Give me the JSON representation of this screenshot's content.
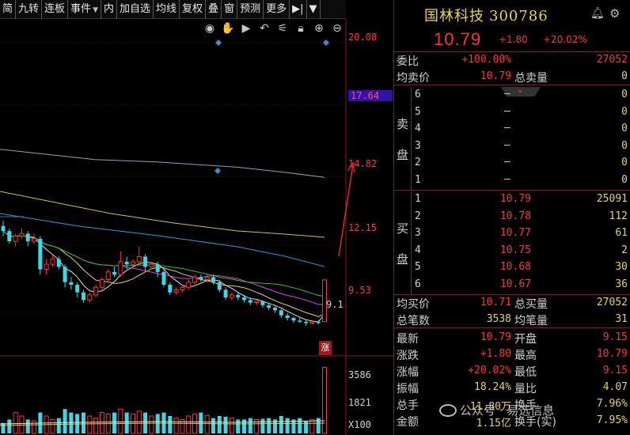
{
  "toolbar": {
    "items": [
      "简",
      "九转",
      "连板",
      "事件",
      "内",
      "加自选",
      "均线",
      "复权",
      "叠",
      "窗",
      "预测",
      "更多"
    ],
    "events_caret": "▼",
    "collapse_icon": "▶|",
    "menu_caret": "▼"
  },
  "chart_tools": [
    "eye-icon",
    "hand-icon",
    "play-icon",
    "undo-icon",
    "wand-icon",
    "lock-icon",
    "zoom-in-icon",
    "zoom-out-icon"
  ],
  "chart": {
    "y_labels": [
      "20.08",
      "17.64",
      "14.82",
      "12.15",
      "9.53"
    ],
    "highlight_label": "17.64",
    "low_tag": "9.1",
    "limit_tag": "涨",
    "volume_labels": [
      "3586",
      "1821",
      "X100"
    ]
  },
  "chart_data": {
    "type": "candlestick",
    "y_range": [
      8.0,
      21.0
    ],
    "candles": [
      [
        12.9,
        12.7,
        13.1,
        12.5
      ],
      [
        12.7,
        12.3,
        12.8,
        12.2
      ],
      [
        12.3,
        12.5,
        12.6,
        12.1
      ],
      [
        12.5,
        12.6,
        12.8,
        12.4
      ],
      [
        12.6,
        12.3,
        12.7,
        12.1
      ],
      [
        12.3,
        12.4,
        12.6,
        12.2
      ],
      [
        12.4,
        11.2,
        12.5,
        11.0
      ],
      [
        11.2,
        11.4,
        11.6,
        11.0
      ],
      [
        11.4,
        11.6,
        11.8,
        11.3
      ],
      [
        11.6,
        11.3,
        11.7,
        11.2
      ],
      [
        11.3,
        10.7,
        11.4,
        10.5
      ],
      [
        10.7,
        10.6,
        10.9,
        10.4
      ],
      [
        10.6,
        10.3,
        10.7,
        10.1
      ],
      [
        10.3,
        10.0,
        10.4,
        9.9
      ],
      [
        10.0,
        10.2,
        10.3,
        9.9
      ],
      [
        10.2,
        10.5,
        10.6,
        10.1
      ],
      [
        10.5,
        10.8,
        10.9,
        10.4
      ],
      [
        10.8,
        11.1,
        11.2,
        10.7
      ],
      [
        11.1,
        11.0,
        11.3,
        10.9
      ],
      [
        11.0,
        11.5,
        11.9,
        10.9
      ],
      [
        11.5,
        11.4,
        11.7,
        11.2
      ],
      [
        11.4,
        11.5,
        11.6,
        11.3
      ],
      [
        11.5,
        11.7,
        12.1,
        11.4
      ],
      [
        11.7,
        11.3,
        11.8,
        11.1
      ],
      [
        11.3,
        11.4,
        11.5,
        11.2
      ],
      [
        11.4,
        11.1,
        11.5,
        10.9
      ],
      [
        11.1,
        10.6,
        11.2,
        10.5
      ],
      [
        10.6,
        10.3,
        10.7,
        10.2
      ],
      [
        10.3,
        10.4,
        10.5,
        10.2
      ],
      [
        10.4,
        10.5,
        10.6,
        10.3
      ],
      [
        10.5,
        10.7,
        10.8,
        10.4
      ],
      [
        10.7,
        10.9,
        11.0,
        10.6
      ],
      [
        10.9,
        10.8,
        11.0,
        10.7
      ],
      [
        10.8,
        10.9,
        11.0,
        10.7
      ],
      [
        10.9,
        10.7,
        11.0,
        10.6
      ],
      [
        10.7,
        10.4,
        10.8,
        10.3
      ],
      [
        10.4,
        10.1,
        10.5,
        10.0
      ],
      [
        10.1,
        10.2,
        10.3,
        10.0
      ],
      [
        10.2,
        10.1,
        10.3,
        10.0
      ],
      [
        10.1,
        10.0,
        10.2,
        9.9
      ],
      [
        10.0,
        9.9,
        10.1,
        9.8
      ],
      [
        9.9,
        9.95,
        10.0,
        9.8
      ],
      [
        9.95,
        9.8,
        10.0,
        9.7
      ],
      [
        9.8,
        9.7,
        9.9,
        9.6
      ],
      [
        9.7,
        9.6,
        9.8,
        9.5
      ],
      [
        9.6,
        9.4,
        9.7,
        9.3
      ],
      [
        9.4,
        9.3,
        9.5,
        9.2
      ],
      [
        9.3,
        9.2,
        9.35,
        9.1
      ],
      [
        9.2,
        9.15,
        9.3,
        9.1
      ],
      [
        9.15,
        9.1,
        9.2,
        9.0
      ],
      [
        9.1,
        9.15,
        9.2,
        9.05
      ],
      [
        9.15,
        9.1,
        9.2,
        9.05
      ],
      [
        9.15,
        10.79,
        10.79,
        9.15
      ]
    ],
    "ma_long": [
      [
        0,
        15.9
      ],
      [
        60,
        15.7
      ],
      [
        120,
        15.5
      ],
      [
        200,
        15.4
      ],
      [
        300,
        15.2
      ],
      [
        360,
        15.0
      ],
      [
        410,
        14.8
      ]
    ],
    "volumes": [
      0.15,
      0.2,
      0.3,
      0.25,
      0.2,
      0.18,
      0.3,
      0.25,
      0.2,
      0.22,
      0.35,
      0.3,
      0.28,
      0.3,
      0.25,
      0.22,
      0.3,
      0.28,
      0.3,
      0.35,
      0.3,
      0.28,
      0.32,
      0.3,
      0.25,
      0.28,
      0.3,
      0.25,
      0.22,
      0.2,
      0.25,
      0.28,
      0.3,
      0.26,
      0.22,
      0.25,
      0.24,
      0.22,
      0.2,
      0.2,
      0.22,
      0.2,
      0.21,
      0.22,
      0.2,
      0.25,
      0.22,
      0.2,
      0.22,
      0.18,
      0.2,
      0.22,
      0.95
    ]
  },
  "quote": {
    "name": "国林科技",
    "code": "300786",
    "last": "10.79",
    "change": "+1.80",
    "change_pct": "+20.02%",
    "weibi_label": "委比",
    "weibi_pct": "+100.00%",
    "weibi_diff": "27052",
    "ask_avg_label": "均卖价",
    "ask_avg": "10.79",
    "ask_total_label": "总卖量",
    "ask_total": "0",
    "ask_side": [
      "卖",
      "盘"
    ],
    "asks": [
      {
        "level": "6",
        "price": "–",
        "vol": "0"
      },
      {
        "level": "5",
        "price": "–",
        "vol": "0"
      },
      {
        "level": "4",
        "price": "–",
        "vol": "0"
      },
      {
        "level": "3",
        "price": "–",
        "vol": "0"
      },
      {
        "level": "2",
        "price": "–",
        "vol": "0"
      },
      {
        "level": "1",
        "price": "–",
        "vol": "0"
      }
    ],
    "bid_side": [
      "买",
      "盘"
    ],
    "bids": [
      {
        "level": "1",
        "price": "10.79",
        "vol": "25091"
      },
      {
        "level": "2",
        "price": "10.78",
        "vol": "112"
      },
      {
        "level": "3",
        "price": "10.77",
        "vol": "61"
      },
      {
        "level": "4",
        "price": "10.75",
        "vol": "2"
      },
      {
        "level": "5",
        "price": "10.68",
        "vol": "30"
      },
      {
        "level": "6",
        "price": "10.67",
        "vol": "36"
      }
    ],
    "bid_avg_label": "均买价",
    "bid_avg": "10.71",
    "bid_total_label": "总买量",
    "bid_total": "27052",
    "trades_label": "总笔数",
    "trades": "3538",
    "avg_trade_label": "均笔量",
    "avg_trade": "31",
    "stats": [
      {
        "l1": "最新",
        "v1": "10.79",
        "l2": "开盘",
        "v2": "9.15"
      },
      {
        "l1": "涨跌",
        "v1": "+1.80",
        "l2": "最高",
        "v2": "10.79"
      },
      {
        "l1": "涨幅",
        "v1": "+20.02%",
        "l2": "最低",
        "v2": "9.15"
      },
      {
        "l1": "振幅",
        "v1": "18.24%",
        "l2": "量比",
        "v2": "4.07"
      },
      {
        "l1": "总手",
        "v1": "11.80万",
        "l2": "换手",
        "v2": "7.96%"
      },
      {
        "l1": "金额",
        "v1": "1.15亿",
        "l2": "换手(实)",
        "v2": "7.95%"
      }
    ]
  },
  "watermark": "公众号 · 易选信息"
}
